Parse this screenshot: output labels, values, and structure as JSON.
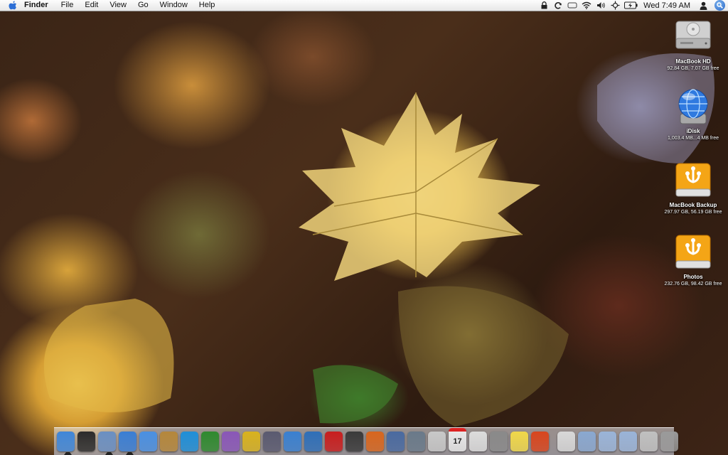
{
  "menubar": {
    "app_name": "Finder",
    "items": [
      "File",
      "Edit",
      "View",
      "Go",
      "Window",
      "Help"
    ],
    "clock": "Wed 7:49 AM",
    "status_icons": [
      "lock-icon",
      "sync-icon",
      "display-icon",
      "wifi-icon",
      "volume-icon",
      "input-icon",
      "battery-icon",
      "user-icon",
      "spotlight-icon"
    ]
  },
  "desktop_icons": [
    {
      "name": "MacBook HD",
      "info": "92.84 GB, 7.07 GB free",
      "icon": "hard-drive-icon"
    },
    {
      "name": "iDisk",
      "info": "1,003.4 MB...4 MB free",
      "icon": "idisk-globe-icon"
    },
    {
      "name": "MacBook Backup",
      "info": "297.97 GB, 56.19 GB free",
      "icon": "firewire-drive-icon"
    },
    {
      "name": "Photos",
      "info": "232.76 GB, 98.42 GB free",
      "icon": "firewire-drive-icon"
    }
  ],
  "dock": {
    "apps": [
      {
        "icon": "finder-icon",
        "color": "#3f86d8",
        "running": true
      },
      {
        "icon": "dashboard-icon",
        "color": "#2b2b2b",
        "running": false
      },
      {
        "icon": "mail-icon",
        "color": "#6a8fc2",
        "running": true
      },
      {
        "icon": "safari-icon",
        "color": "#3a7ed4",
        "running": true
      },
      {
        "icon": "ichat-icon",
        "color": "#4a90e2",
        "running": false
      },
      {
        "icon": "address-book-icon",
        "color": "#b5873b",
        "running": false
      },
      {
        "icon": "msn-icon",
        "color": "#1f8fd8",
        "running": false
      },
      {
        "icon": "excel-icon",
        "color": "#2f8a2f",
        "running": false
      },
      {
        "icon": "entourage-icon",
        "color": "#8a57b8",
        "running": false
      },
      {
        "icon": "powerpoint-icon",
        "color": "#d8b21e",
        "running": false
      },
      {
        "icon": "script-icon",
        "color": "#5a5a70",
        "running": false
      },
      {
        "icon": "itunes-icon",
        "color": "#3a80d0",
        "running": false
      },
      {
        "icon": "word-icon",
        "color": "#2f6fb8",
        "running": false
      },
      {
        "icon": "acrobat-icon",
        "color": "#c81e1e",
        "running": false
      },
      {
        "icon": "camera-icon",
        "color": "#3a3a3a",
        "running": false
      },
      {
        "icon": "firefox-icon",
        "color": "#d8661e",
        "running": false
      },
      {
        "icon": "iphoto-icon",
        "color": "#4a6aa0",
        "running": false
      },
      {
        "icon": "preview-icon",
        "color": "#6a7a8a",
        "running": false
      },
      {
        "icon": "printer-icon",
        "color": "#c8c8c8",
        "running": false
      },
      {
        "icon": "ical-icon",
        "color": "#e8e8e8",
        "running": false
      },
      {
        "icon": "textedit-icon",
        "color": "#dcdcdc",
        "running": false
      },
      {
        "icon": "calculator-icon",
        "color": "#8a8a8a",
        "running": false
      },
      {
        "icon": "stickies-icon",
        "color": "#f0d84a",
        "running": false
      },
      {
        "icon": "parallels-icon",
        "color": "#d8461e",
        "running": false
      }
    ],
    "ical_day": "17",
    "places": [
      {
        "icon": "home-folder-icon",
        "color": "#d8d8d8"
      },
      {
        "icon": "applications-folder-icon",
        "color": "#8aa8d0"
      },
      {
        "icon": "documents-folder-icon",
        "color": "#9ab4d8"
      },
      {
        "icon": "downloads-folder-icon",
        "color": "#9ab4d8"
      },
      {
        "icon": "stack-icon",
        "color": "#c0c0c0"
      },
      {
        "icon": "trash-icon",
        "color": "#9a9a9a"
      }
    ]
  }
}
